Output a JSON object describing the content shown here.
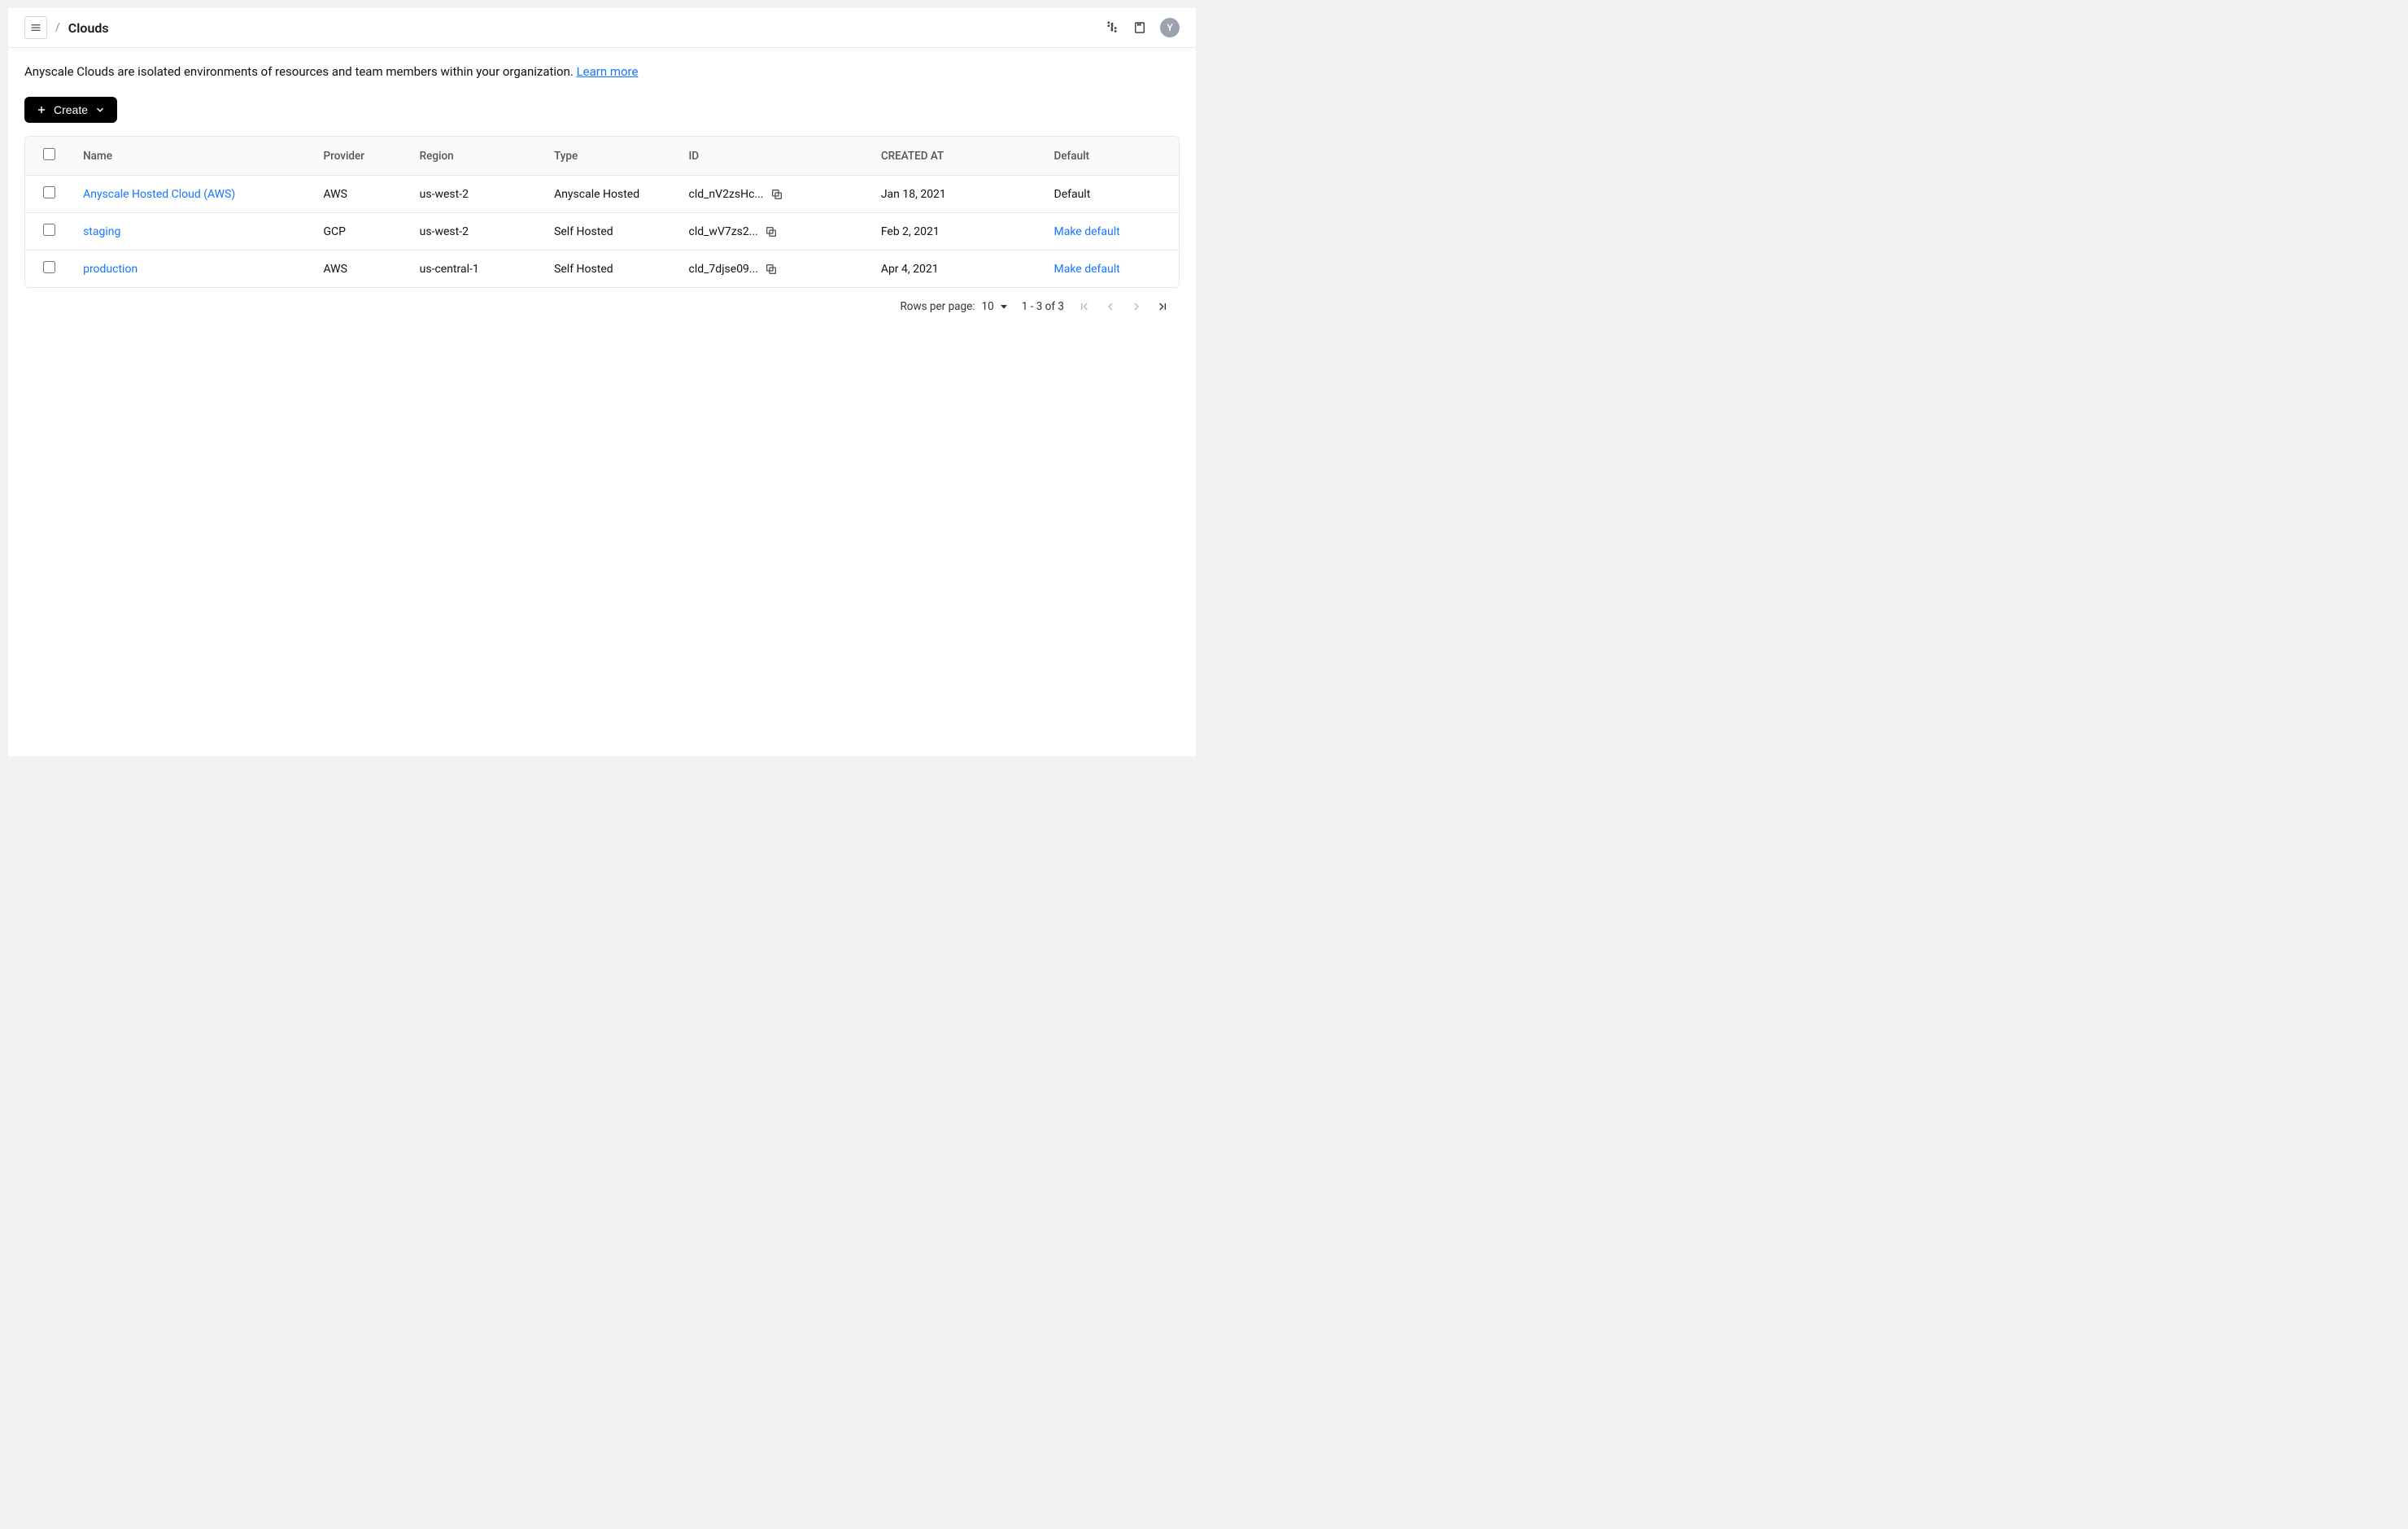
{
  "header": {
    "title": "Clouds",
    "avatar_initial": "Y"
  },
  "description": {
    "text": "Anyscale Clouds are isolated environments of resources and team members within your organization. ",
    "learn_more": "Learn more"
  },
  "create_button": {
    "label": "Create"
  },
  "table": {
    "columns": {
      "name": "Name",
      "provider": "Provider",
      "region": "Region",
      "type": "Type",
      "id": "ID",
      "created_at": "CREATED AT",
      "default": "Default"
    },
    "rows": [
      {
        "name": "Anyscale Hosted Cloud (AWS)",
        "provider": "AWS",
        "region": "us-west-2",
        "type": "Anyscale Hosted",
        "id": "cld_nV2zsHc...",
        "created_at": "Jan 18, 2021",
        "default_text": "Default",
        "default_is_link": false
      },
      {
        "name": "staging",
        "provider": "GCP",
        "region": "us-west-2",
        "type": "Self Hosted",
        "id": "cld_wV7zs2...",
        "created_at": "Feb 2, 2021",
        "default_text": "Make default",
        "default_is_link": true
      },
      {
        "name": "production",
        "provider": "AWS",
        "region": "us-central-1",
        "type": "Self Hosted",
        "id": "cld_7djse09...",
        "created_at": "Apr 4, 2021",
        "default_text": "Make default",
        "default_is_link": true
      }
    ]
  },
  "pagination": {
    "rows_per_page_label": "Rows per page:",
    "rows_per_page_value": "10",
    "range_text": "1 - 3  of  3"
  }
}
